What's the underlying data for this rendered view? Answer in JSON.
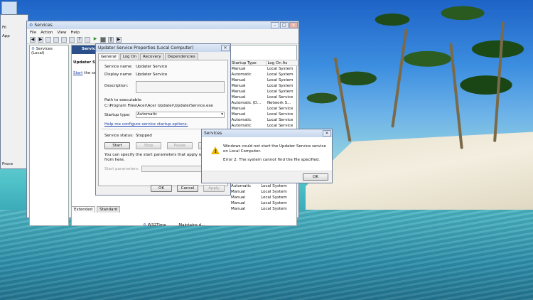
{
  "services_window": {
    "title": "Services",
    "menu": [
      "File",
      "Action",
      "View",
      "Help"
    ],
    "tree_item": "Services (Local)",
    "pane_header": "Services",
    "pane_subheader": "Updater Servic",
    "start_link": "Start",
    "start_text": "the servic",
    "columns": [
      "Startup Type",
      "Log On As"
    ],
    "rows": [
      [
        "Manual",
        "Local System"
      ],
      [
        "Automatic",
        "Local System"
      ],
      [
        "Manual",
        "Local System"
      ],
      [
        "Manual",
        "Local System"
      ],
      [
        "Manual",
        "Local System"
      ],
      [
        "Manual",
        "Local Service"
      ],
      [
        "Automatic (D...",
        "Network S..."
      ],
      [
        "Manual",
        "Local Service"
      ],
      [
        "Manual",
        "Local Service"
      ],
      [
        "Automatic",
        "Local Service"
      ],
      [
        "Automatic",
        "Local Service"
      ],
      [
        "Manual",
        "Local System"
      ],
      [
        "Manual",
        "Local System"
      ]
    ],
    "bottom_rows": [
      [
        "Automatic",
        "Local System"
      ],
      [
        "Manual",
        "Local System"
      ],
      [
        "Manual",
        "Local System"
      ],
      [
        "Manual",
        "Local System"
      ],
      [
        "Manual",
        "Local System"
      ]
    ],
    "w32time_name": "W32Time",
    "w32time_desc": "Maintains d...",
    "tabs_bottom": [
      "Extended",
      "Standard"
    ]
  },
  "properties_dialog": {
    "title": "Updater Service Properties (Local Computer)",
    "tabs": [
      "General",
      "Log On",
      "Recovery",
      "Dependencies"
    ],
    "service_name_label": "Service name:",
    "service_name_value": "Updater Service",
    "display_name_label": "Display name:",
    "display_name_value": "Updater Service",
    "description_label": "Description:",
    "path_label": "Path to executable:",
    "path_value": "C:\\Program Files\\Acer\\Acer Updater\\UpdaterService.exe",
    "startup_label": "Startup type:",
    "startup_value": "Automatic",
    "help_link": "Help me configure service startup options.",
    "status_label": "Service status:",
    "status_value": "Stopped",
    "start_btn": "Start",
    "stop_btn": "Stop",
    "pause_btn": "Pause",
    "hint": "You can specify the start parameters that apply when you start",
    "hint2": "from here.",
    "params_label": "Start parameters:",
    "ok": "OK",
    "cancel": "Cancel",
    "apply": "Apply"
  },
  "error_dialog": {
    "title": "Services",
    "message": "Windows could not start the Updater Service service on Local Computer.",
    "error": "Error 2: The system cannot find the file specified.",
    "ok": "OK"
  },
  "behind_window": {
    "labels": [
      "Fil",
      "App",
      "Proce"
    ]
  }
}
